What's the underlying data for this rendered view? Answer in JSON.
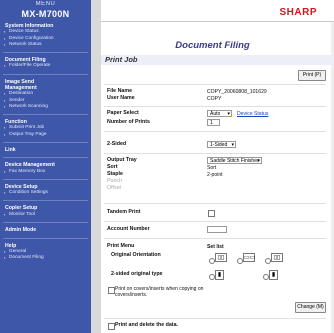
{
  "sidebar": {
    "header": "MENU",
    "model": "MX-M700N",
    "sections": [
      {
        "title": "System Information",
        "links": [
          "Device Status",
          "Device Configuration",
          "Network Status"
        ]
      },
      {
        "title": "Document Filing",
        "links": [
          "Folder/File Operate"
        ]
      },
      {
        "title": "Image Send Management",
        "links": [
          "Destination",
          "Sender",
          "Network Scanning"
        ]
      },
      {
        "title": "Function",
        "links": [
          "Submit Print Job",
          "Output Tray Page"
        ]
      },
      {
        "title": "Link",
        "links": []
      },
      {
        "title": "Device Management",
        "links": [
          "Fax Memory Box"
        ]
      },
      {
        "title": "Device Setup",
        "links": [
          "Condition Settings"
        ]
      },
      {
        "title": "Copier Setup",
        "links": [
          "Monitor Tool"
        ]
      },
      {
        "title": "Admin Mode",
        "links": []
      },
      {
        "title": "Help",
        "links": [
          "General",
          "Document Filing"
        ]
      }
    ]
  },
  "header": {
    "logo": "SHARP"
  },
  "page": {
    "title": "Document Filing",
    "section": "Print Job",
    "print_button": "Print (P)"
  },
  "job": {
    "file_name_label": "File Name",
    "file_name": "COPY_20060808_101629",
    "user_name_label": "User Name",
    "user_name": "COPY",
    "paper_select_label": "Paper Select",
    "paper_select_value": "Auto",
    "device_status_link": "Device Status",
    "number_of_prints_label": "Number of Prints",
    "number_of_prints": "1",
    "two_sided_label": "2-Sided",
    "two_sided_value": "1-Sided",
    "output_tray_label": "Output Tray",
    "output_tray_value": "Saddle Stitch Finisher",
    "sort_label": "Sort",
    "sort_value": "Sort",
    "staple_label": "Staple",
    "staple_value": "2-point",
    "punch_label": "Punch",
    "offset_label": "Offset",
    "tandem_label": "Tandem Print",
    "account_label": "Account Number",
    "print_menu_label": "Print Menu",
    "print_menu_value": "Set list",
    "orientation_label": "Original Orientation",
    "two_sided_type_label": "2-sided original type",
    "covers_text": "Print on covers/inserts when copying on covers/inserts.",
    "change_button": "Change (M)",
    "print_delete_label": "Print and delete the data."
  }
}
